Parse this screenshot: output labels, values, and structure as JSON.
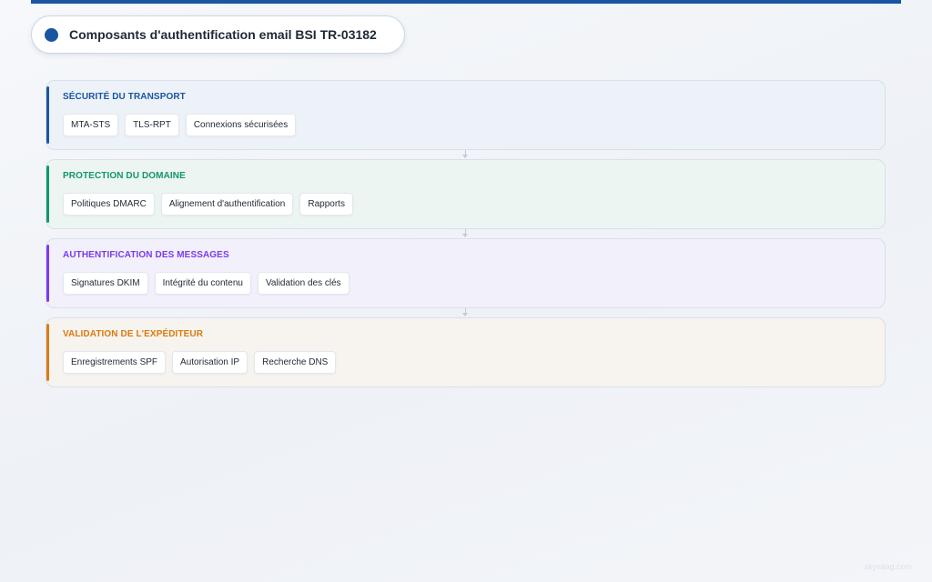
{
  "header": {
    "title": "Composants d'authentification email BSI TR-03182"
  },
  "layers": [
    {
      "title": "SÉCURITÉ DU TRANSPORT",
      "color": "#1a56a0",
      "items": [
        "MTA-STS",
        "TLS-RPT",
        "Connexions sécurisées"
      ]
    },
    {
      "title": "PROTECTION DU DOMAINE",
      "color": "#12966a",
      "items": [
        "Politiques DMARC",
        "Alignement d'authentification",
        "Rapports"
      ]
    },
    {
      "title": "AUTHENTIFICATION DES MESSAGES",
      "color": "#7c3aed",
      "items": [
        "Signatures DKIM",
        "Intégrité du contenu",
        "Validation des clés"
      ]
    },
    {
      "title": "VALIDATION DE L'EXPÉDITEUR",
      "color": "#db7a10",
      "items": [
        "Enregistrements SPF",
        "Autorisation IP",
        "Recherche DNS"
      ]
    }
  ],
  "footer": {
    "watermark": "skyvaag.com"
  }
}
